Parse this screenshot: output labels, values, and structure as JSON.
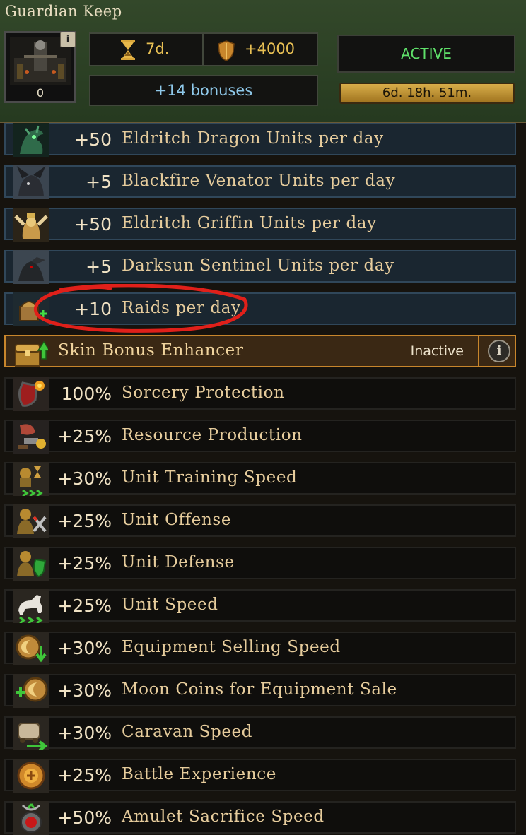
{
  "header": {
    "title": "Guardian Keep",
    "portrait_count": "0",
    "info_label": "i",
    "duration": "7d.",
    "power": "+4000",
    "bonuses": "+14 bonuses",
    "status": "ACTIVE",
    "timer": "6d. 18h. 51m."
  },
  "unit_rows": [
    {
      "value": "+50",
      "label": "Eldritch Dragon Units per day",
      "icon": "dragon-icon"
    },
    {
      "value": "+5",
      "label": "Blackfire Venator Units per day",
      "icon": "venator-icon"
    },
    {
      "value": "+50",
      "label": "Eldritch Griffin Units per day",
      "icon": "griffin-icon"
    },
    {
      "value": "+5",
      "label": "Darksun Sentinel Units per day",
      "icon": "sentinel-icon"
    },
    {
      "value": "+10",
      "label": "Raids per day",
      "icon": "raid-icon"
    }
  ],
  "skin_enhancer": {
    "label": "Skin Bonus Enhancer",
    "status": "Inactive",
    "info": "i"
  },
  "bonus_rows": [
    {
      "value": "100%",
      "label": "Sorcery Protection",
      "icon": "sorcery-shield-icon"
    },
    {
      "value": "+25%",
      "label": "Resource Production",
      "icon": "resources-icon"
    },
    {
      "value": "+30%",
      "label": "Unit Training Speed",
      "icon": "training-speed-icon"
    },
    {
      "value": "+25%",
      "label": "Unit Offense",
      "icon": "offense-icon"
    },
    {
      "value": "+25%",
      "label": "Unit Defense",
      "icon": "defense-icon"
    },
    {
      "value": "+25%",
      "label": "Unit Speed",
      "icon": "horse-speed-icon"
    },
    {
      "value": "+30%",
      "label": "Equipment Selling Speed",
      "icon": "moon-coin-down-icon"
    },
    {
      "value": "+30%",
      "label": "Moon Coins for Equipment Sale",
      "icon": "moon-coin-plus-icon"
    },
    {
      "value": "+30%",
      "label": "Caravan Speed",
      "icon": "caravan-icon"
    },
    {
      "value": "+25%",
      "label": "Battle Experience",
      "icon": "experience-icon"
    },
    {
      "value": "+50%",
      "label": "Amulet Sacrifice Speed",
      "icon": "amulet-icon"
    }
  ],
  "colors": {
    "active": "#5fe06a",
    "accent": "#e8c054",
    "annotation": "#e0201a"
  }
}
